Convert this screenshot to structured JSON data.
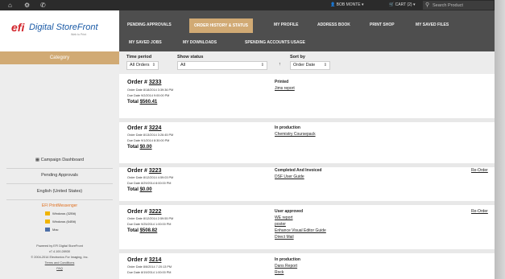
{
  "topbar": {
    "home_icon": "home-icon",
    "settings_icon": "gear-icon",
    "phone_icon": "phone-icon",
    "user": "BOB MONTE",
    "cart": "CART (2)",
    "search_placeholder": "Search Product"
  },
  "logo": {
    "efi": "efi",
    "name": "Digital StoreFront",
    "tagline": "Web to Print"
  },
  "sidebar": {
    "category_label": "Category",
    "links": [
      "Campaign Dashboard",
      "Pending Approvals",
      "English (United States)"
    ],
    "print_messenger_title": "EFI PrintMessenger",
    "downloads": [
      {
        "label": "Windows (32Bit)",
        "icon": "windows-icon"
      },
      {
        "label": "Windows (64Bit)",
        "icon": "windows-icon"
      },
      {
        "label": "Mac",
        "icon": "mac-icon"
      }
    ],
    "footer": [
      "Powered by EFI Digital StoreFront",
      "v7.4.100.28930",
      "© 2004-2014 Electronics For Imaging, Inc.",
      "Terms and Conditions",
      "FAQ"
    ]
  },
  "nav": {
    "row1": [
      "PENDING APPROVALS",
      "ORDER HISTORY & STATUS",
      "MY PROFILE",
      "ADDRESS BOOK",
      "PRINT SHOP",
      "MY SAVED FILES"
    ],
    "row2": [
      "MY SAVED JOBS",
      "MY DOWNLOADS",
      "SPENDING ACCOUNTS USAGE"
    ],
    "active": "ORDER HISTORY & STATUS"
  },
  "filters": {
    "time_period_label": "Time period",
    "time_period_value": "All Orders",
    "show_status_label": "Show status",
    "show_status_value": "All",
    "sort_by_label": "Sort by",
    "sort_dir": "↑",
    "sort_value": "Order Date"
  },
  "orders": [
    {
      "prefix": "Order # ",
      "number": "3233",
      "order_date": "Order Date 8/18/2014 3:39:36 PM",
      "due_date": "Due Date 9/2/2014 9:00:00 PM",
      "total_label": "Total ",
      "total": "$560.41",
      "status": "Printed",
      "jobs": [
        "Jims report"
      ],
      "reorder": ""
    },
    {
      "prefix": "Order # ",
      "number": "3224",
      "order_date": "Order Date 8/13/2014 3:26:45 PM",
      "due_date": "Due Date 9/1/2014 8:30:00 PM",
      "total_label": "Total ",
      "total": "$0.00",
      "status": "In production",
      "jobs": [
        "Chemistry Coursepack"
      ],
      "reorder": ""
    },
    {
      "prefix": "Order # ",
      "number": "3223",
      "order_date": "Order Date 8/12/2014 4:59:03 PM",
      "due_date": "Due Date 8/29/2014 8:00:00 PM",
      "total_label": "Total ",
      "total": "$0.00",
      "status": "Completed And Invoiced",
      "jobs": [
        "DSF User Guide"
      ],
      "reorder": "Re-Order"
    },
    {
      "prefix": "Order # ",
      "number": "3222",
      "order_date": "Order Date 8/12/2014 2:59:55 PM",
      "due_date": "Due Date 9/25/2014 1:00:00 PM",
      "total_label": "Total ",
      "total": "$508.82",
      "status": "User approved",
      "jobs": [
        "WE report",
        "poster",
        "Enhance Visual Editor Guide",
        "Direct Mail"
      ],
      "reorder": "Re-Order"
    },
    {
      "prefix": "Order # ",
      "number": "3214",
      "order_date": "Order Date 8/6/2014 7:20:13 PM",
      "due_date": "Due Date 8/19/2014 1:00:00 PM",
      "total_label": "",
      "total": "",
      "status": "In production",
      "jobs": [
        "Dans Report",
        "Rock"
      ],
      "reorder": ""
    }
  ]
}
